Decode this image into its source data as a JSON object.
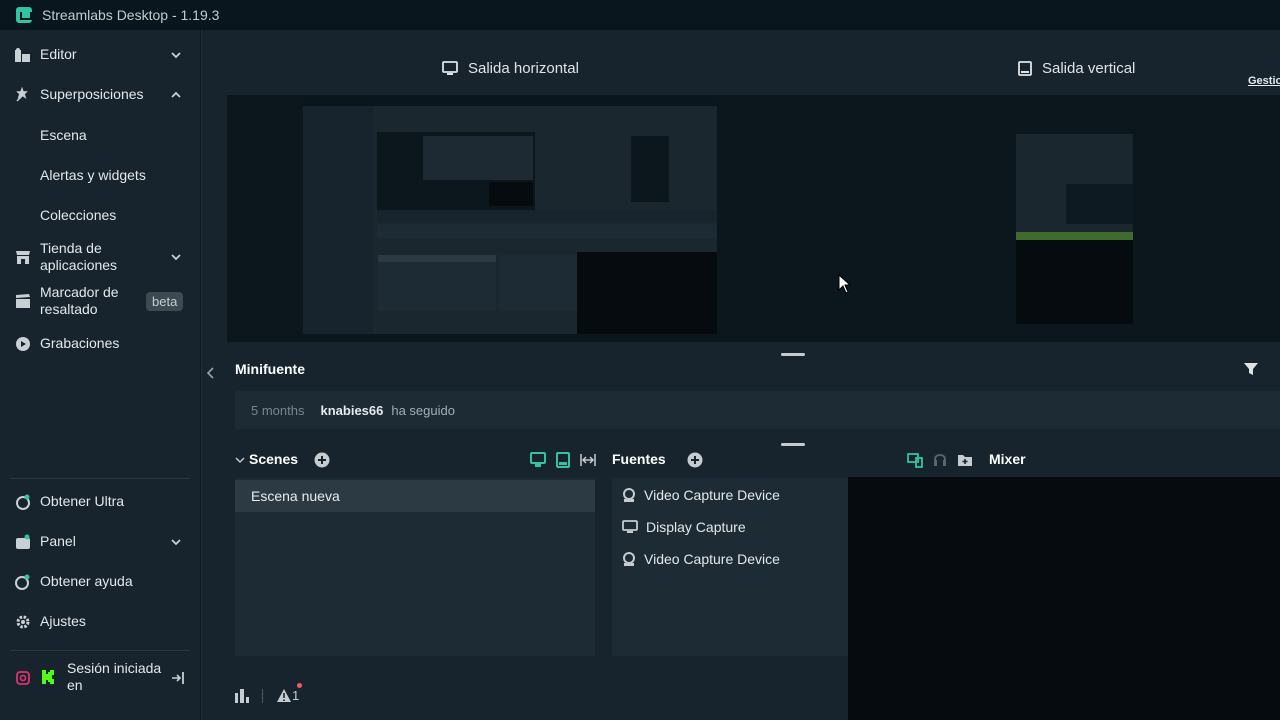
{
  "window": {
    "title": "Streamlabs Desktop - 1.19.3"
  },
  "sidebar": {
    "editor": "Editor",
    "overlays": "Superposiciones",
    "sub": [
      "Escena",
      "Alertas y widgets",
      "Colecciones"
    ],
    "app_store": "Tienda de aplicaciones",
    "highlighter": "Marcador de resaltado",
    "beta": "beta",
    "recordings": "Grabaciones",
    "ultra": "Obtener Ultra",
    "panel": "Panel",
    "help": "Obtener ayuda",
    "settings": "Ajustes",
    "session": "Sesión iniciada en"
  },
  "outputs": {
    "horizontal": "Salida horizontal",
    "vertical": "Salida vertical",
    "manage": "Gestio"
  },
  "minifeed": {
    "title": "Minifuente",
    "event": {
      "time": "5 months",
      "user": "knabies66",
      "action": "ha seguido"
    }
  },
  "scenes": {
    "title": "Scenes",
    "items": [
      "Escena nueva"
    ]
  },
  "sources": {
    "title": "Fuentes",
    "items": [
      {
        "name": "Video Capture Device",
        "icon": "webcam-icon"
      },
      {
        "name": "Display Capture",
        "icon": "monitor-icon"
      },
      {
        "name": "Video Capture Device",
        "icon": "webcam-icon"
      }
    ]
  },
  "mixer": {
    "title": "Mixer"
  },
  "footer": {
    "alerts": "1"
  },
  "colors": {
    "accent": "#31c3a2",
    "bg": "#17242d",
    "dark": "#09161d"
  }
}
